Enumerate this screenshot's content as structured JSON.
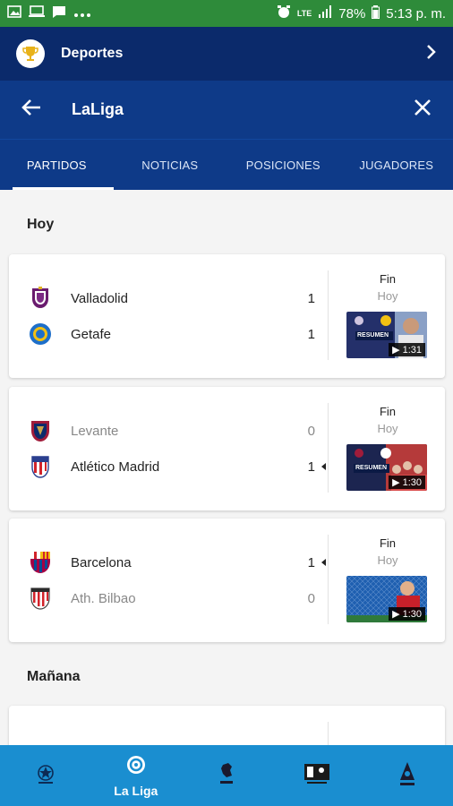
{
  "status_bar": {
    "signal": "LTE",
    "battery": "78%",
    "time": "5:13 p. m."
  },
  "header": {
    "title": "Deportes"
  },
  "search": {
    "query": "LaLiga"
  },
  "tabs": [
    {
      "label": "PARTIDOS",
      "active": true
    },
    {
      "label": "NOTICIAS"
    },
    {
      "label": "POSICIONES"
    },
    {
      "label": "JUGADORES"
    }
  ],
  "sections": {
    "today": "Hoy",
    "tomorrow": "Mañana"
  },
  "matches": [
    {
      "home": {
        "name": "Valladolid",
        "score": "1"
      },
      "away": {
        "name": "Getafe",
        "score": "1"
      },
      "status": "Fin",
      "day": "Hoy",
      "duration": "▶ 1:31",
      "video_caption": "RESUMEN"
    },
    {
      "home": {
        "name": "Levante",
        "score": "0"
      },
      "away": {
        "name": "Atlético Madrid",
        "score": "1"
      },
      "status": "Fin",
      "day": "Hoy",
      "duration": "▶ 1:30",
      "video_caption": "RESUMEN"
    },
    {
      "home": {
        "name": "Barcelona",
        "score": "1"
      },
      "away": {
        "name": "Ath. Bilbao",
        "score": "0"
      },
      "status": "Fin",
      "day": "Hoy",
      "duration": "▶ 1:30",
      "video_caption": ""
    }
  ],
  "bottom_nav": [
    {
      "label": "",
      "icon": "champions-league-icon"
    },
    {
      "label": "La Liga",
      "icon": "laliga-icon",
      "active": true
    },
    {
      "label": "",
      "icon": "premier-league-icon"
    },
    {
      "label": "",
      "icon": "bundesliga-icon"
    },
    {
      "label": "",
      "icon": "serie-a-icon"
    }
  ],
  "colors": {
    "status_bar": "#2e8b3a",
    "header": "#0b2a6b",
    "search_bar": "#0e3a88",
    "bottom_nav": "#1a8ed0"
  }
}
